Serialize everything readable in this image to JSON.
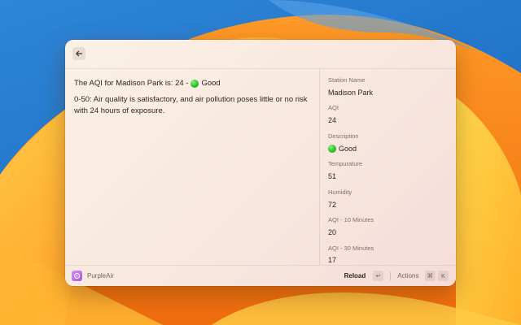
{
  "detail": {
    "title_prefix": "The AQI for Madison Park is: 24 -",
    "title_status": "Good",
    "description": "0-50: Air quality is satisfactory, and air pollution poses little or no risk with 24 hours of exposure."
  },
  "metadata": [
    {
      "label": "Station Name",
      "value": "Madison Park",
      "icon": ""
    },
    {
      "label": "AQI",
      "value": "24",
      "icon": ""
    },
    {
      "label": "Description",
      "value": "Good",
      "icon": "green-circle-icon"
    },
    {
      "label": "Tempurature",
      "value": "51",
      "icon": ""
    },
    {
      "label": "Humidity",
      "value": "72",
      "icon": ""
    },
    {
      "label": "AQI - 10 Minutes",
      "value": "20",
      "icon": ""
    },
    {
      "label": "AQI - 30 Minutes",
      "value": "17",
      "icon": ""
    }
  ],
  "footer": {
    "app_name": "PurpleAir",
    "primary_action": "Reload",
    "primary_shortcut": "↵",
    "actions_label": "Actions",
    "actions_shortcut_1": "⌘",
    "actions_shortcut_2": "K"
  },
  "colors": {
    "good": "#2cc22a",
    "app_icon": "#b56ee8"
  }
}
